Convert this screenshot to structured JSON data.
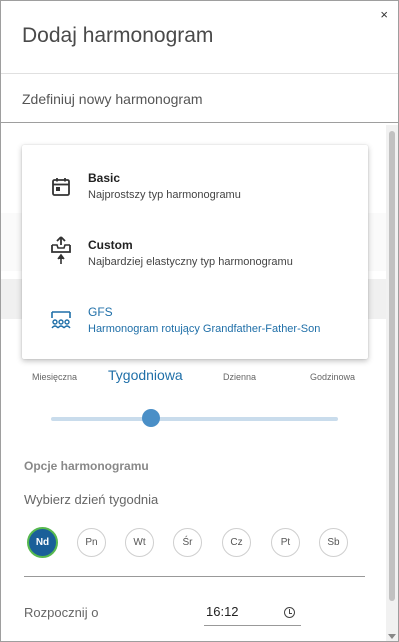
{
  "dialog": {
    "close": "×",
    "title": "Dodaj harmonogram",
    "subtitle": "Zdefiniuj nowy harmonogram"
  },
  "dropdown": {
    "options": [
      {
        "name": "Basic",
        "description": "Najprostszy typ harmonogramu",
        "icon": "calendar-icon"
      },
      {
        "name": "Custom",
        "description": "Najbardziej elastyczny typ harmonogramu",
        "icon": "upload-tray-icon"
      },
      {
        "name": "GFS",
        "description": "Harmonogram rotujący Grandfather-Father-Son",
        "icon": "gfs-icon",
        "selected": true
      }
    ]
  },
  "frequency": {
    "labels": [
      "Miesięczna",
      "Tygodniowa",
      "Dzienna",
      "Godzinowa"
    ],
    "selected": "Tygodniowa",
    "slider_fraction": 0.33
  },
  "options": {
    "section_title": "Opcje harmonogramu",
    "day_label": "Wybierz dzień tygodnia",
    "days": [
      "Nd",
      "Pn",
      "Wt",
      "Śr",
      "Cz",
      "Pt",
      "Sb"
    ],
    "selected_day": "Nd"
  },
  "start": {
    "label": "Rozpocznij o",
    "time": "16:12"
  },
  "colors": {
    "accent": "#1f6fa8",
    "selected_day_fill": "#1a5f99",
    "selected_day_ring": "#57b94f"
  }
}
